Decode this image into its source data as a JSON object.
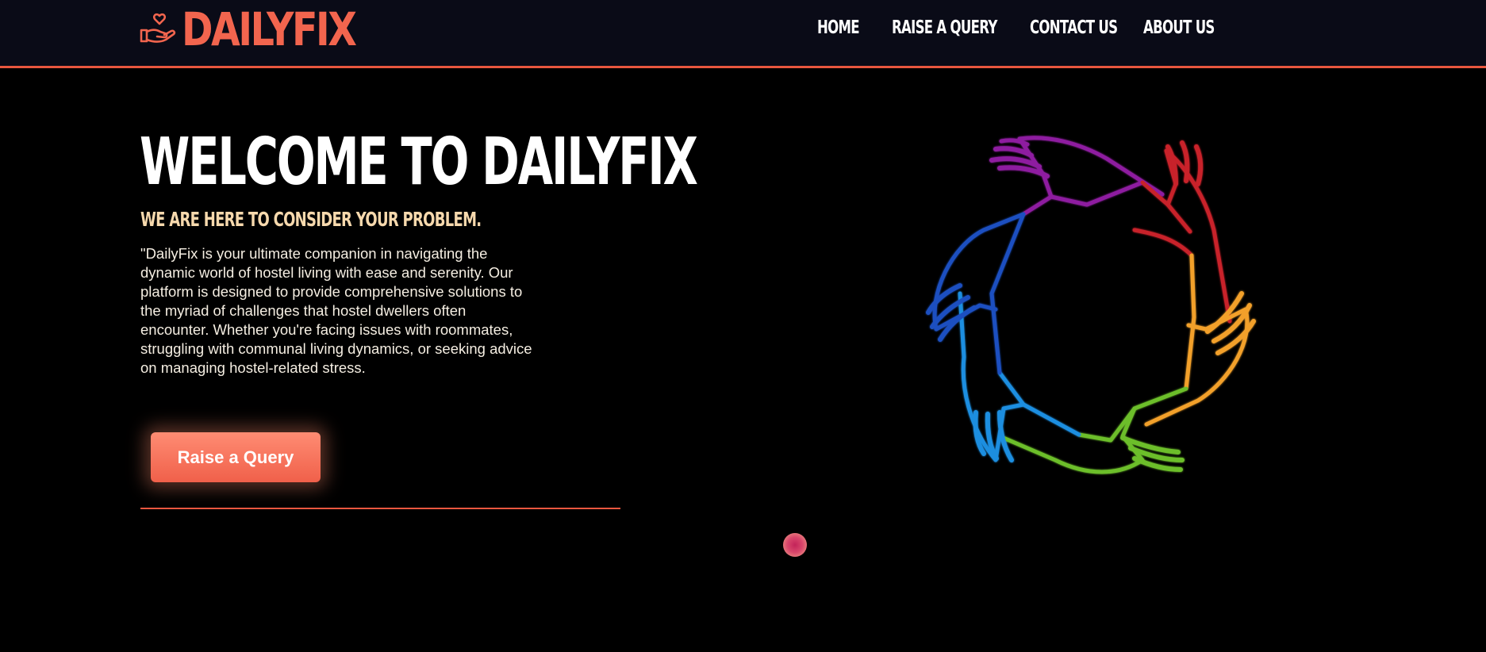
{
  "brand": {
    "name": "DAILYFIX",
    "icon": "hand-heart-icon",
    "color": "#f2654e"
  },
  "nav": {
    "items": [
      {
        "label": "HOME"
      },
      {
        "label": "RAISE A QUERY"
      },
      {
        "label": "CONTACT US"
      },
      {
        "label": "ABOUT US"
      }
    ]
  },
  "hero": {
    "title": "WELCOME TO DAILYFIX",
    "subtitle": "WE ARE HERE TO CONSIDER YOUR PROBLEM.",
    "description": "\"DailyFix is your ultimate companion in navigating the dynamic world of hostel living with ease and serenity. Our platform is designed to provide comprehensive solutions to the myriad of challenges that hostel dwellers often encounter. Whether you're facing issues with roommates, struggling with communal living dynamics, or seeking advice on managing hostel-related stress.",
    "cta_label": "Raise a Query",
    "graphic": "rainbow-hands-circle-icon"
  },
  "colors": {
    "accent": "#e9573f",
    "navbar_bg": "#0a0b17",
    "page_bg": "#000000",
    "subtitle": "#f7d9ad"
  }
}
